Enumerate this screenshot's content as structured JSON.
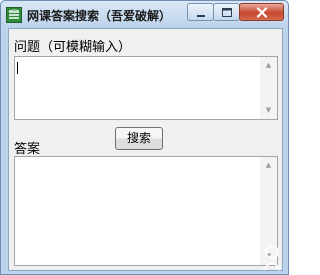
{
  "window": {
    "title": "网课答案搜索（吾爱破解）",
    "icon": "book-stack-icon"
  },
  "form": {
    "question_label": "问题（可模糊输入）",
    "question_value": "",
    "answer_label": "答案",
    "answer_value": "",
    "search_button": "搜索"
  },
  "colors": {
    "titlebar": "#bcd3ec",
    "client_bg": "#f0f0f0",
    "close_button": "#c7482d"
  }
}
